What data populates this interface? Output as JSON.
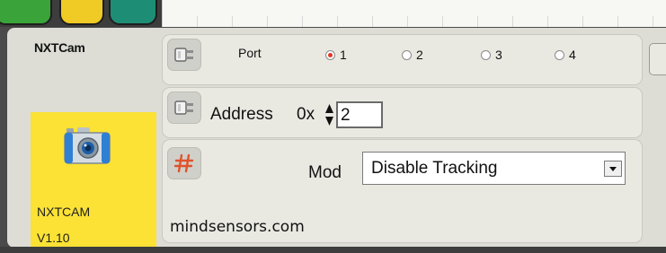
{
  "block": {
    "title": "NXTCam",
    "version_line1": "NXTCAM",
    "version_line2": "V1.10",
    "icon": "camera-icon"
  },
  "port": {
    "label": "Port",
    "options": [
      "1",
      "2",
      "3",
      "4"
    ],
    "selected": "1",
    "icon": "plug-icon"
  },
  "address": {
    "label": "Address",
    "prefix": "0x",
    "value": "2",
    "icon": "plug-icon"
  },
  "mode": {
    "label": "Mod",
    "selected": "Disable Tracking",
    "icon": "hash-icon"
  },
  "footer": "mindsensors.com",
  "colors": {
    "block_bg": "#fbe235",
    "panel_bg": "#ddddd6",
    "row_bg": "#e9e9e2",
    "radio_selected": "#e0382a"
  }
}
